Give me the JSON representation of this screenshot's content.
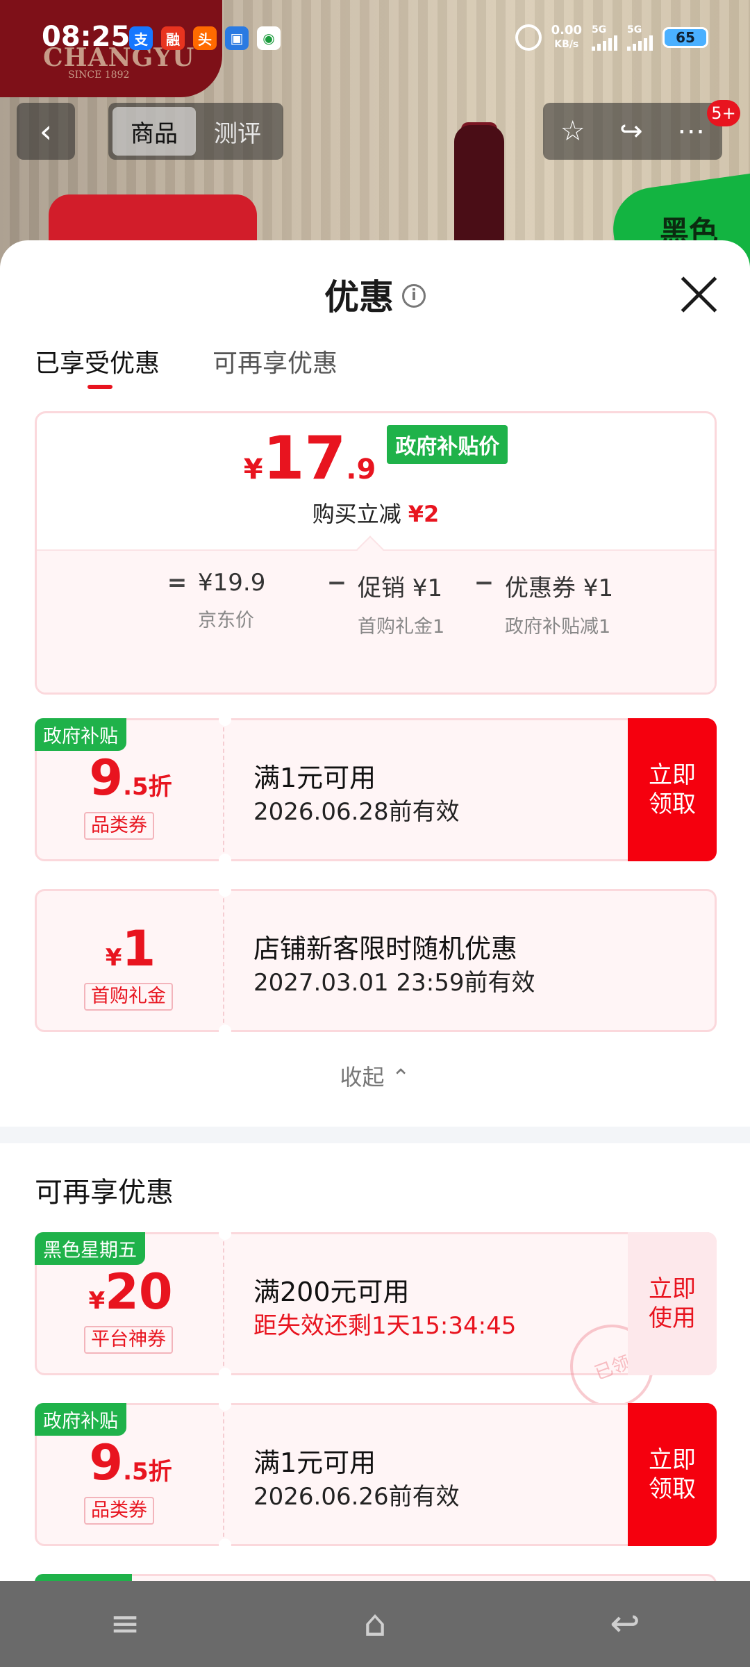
{
  "status_bar": {
    "time": "08:25",
    "apps": [
      "支",
      "融",
      "头",
      "▣",
      "◉"
    ],
    "net_speed": "0.00",
    "net_unit": "KB/s",
    "sim1": "5G",
    "sim2": "5G",
    "battery": "65"
  },
  "background": {
    "brand": "CHANGYU",
    "brand_sub": "SINCE 1892",
    "promo_text": "黑色"
  },
  "top_nav": {
    "back": "‹",
    "tabs": [
      "商品",
      "测评"
    ],
    "active_tab": 0,
    "badge": "5+"
  },
  "sheet": {
    "title": "优惠",
    "info_icon": "i",
    "tabs": [
      "已享受优惠",
      "可再享优惠"
    ],
    "summary": {
      "currency": "¥",
      "price_int": "17",
      "price_dec": ".9",
      "price_tag": "政府补贴价",
      "reduce_label": "购买立减",
      "reduce_value": "¥2",
      "eq": "=",
      "minus": "−",
      "items": [
        {
          "value": "¥19.9",
          "label": "京东价"
        },
        {
          "value": "促销 ¥1",
          "label": "首购礼金1"
        },
        {
          "value": "优惠券 ¥1",
          "label": "政府补贴减1"
        }
      ]
    },
    "coupons": [
      {
        "tag": "政府补贴",
        "amt_big": "9",
        "amt_small": ".5折",
        "type": "品类券",
        "title": "满1元可用",
        "sub": "2026.06.28前有效",
        "button": "立即领取"
      },
      {
        "tag": "",
        "amt_prefix": "¥",
        "amt_big": "1",
        "type": "首购礼金",
        "title": "店铺新客限时随机优惠",
        "sub": "2027.03.01 23:59前有效",
        "button": ""
      }
    ],
    "collapse_label": "收起",
    "section2_title": "可再享优惠",
    "more_coupons": [
      {
        "tag": "黑色星期五",
        "amt_prefix": "¥",
        "amt_big": "20",
        "type": "平台神券",
        "title": "满200元可用",
        "sub": "距失效还剩1天15:34:45",
        "button": "立即使用",
        "stamp": "已领"
      },
      {
        "tag": "政府补贴",
        "amt_big": "9",
        "amt_small": ".5折",
        "type": "品类券",
        "title": "满1元可用",
        "sub": "2026.06.26前有效",
        "button": "立即领取"
      }
    ]
  },
  "colors": {
    "accent_red": "#e8141f",
    "tag_green": "#1fb24a",
    "coupon_bg": "#fff5f6"
  },
  "system_nav": {
    "menu": "≡",
    "home": "⌂",
    "back": "↩"
  }
}
